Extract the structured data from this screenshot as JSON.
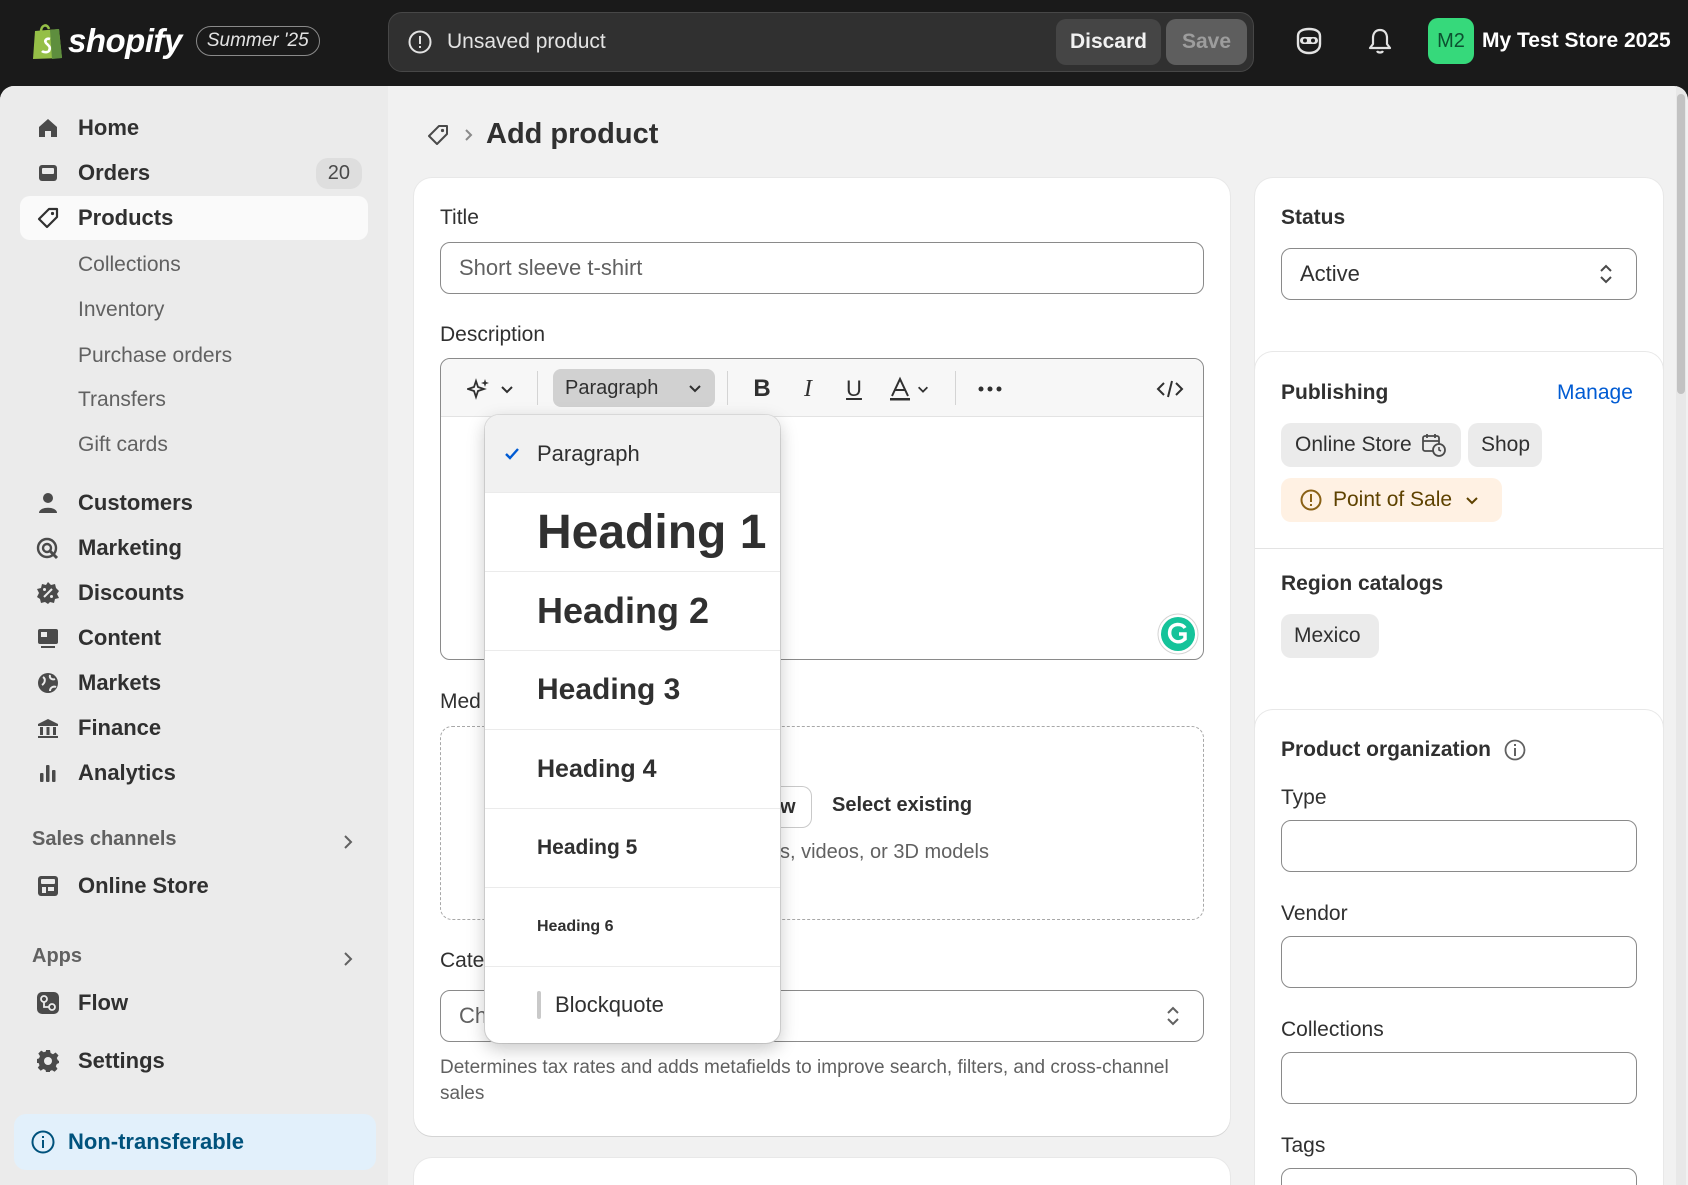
{
  "topbar": {
    "brand": "shopify",
    "edition": "Summer '25",
    "unsaved_text": "Unsaved product",
    "discard_label": "Discard",
    "save_label": "Save",
    "avatar_initials": "M2",
    "store_name": "My Test Store 2025"
  },
  "sidebar": {
    "items": [
      {
        "label": "Home",
        "icon": "home-icon"
      },
      {
        "label": "Orders",
        "icon": "orders-icon",
        "badge": "20"
      },
      {
        "label": "Products",
        "icon": "tag-icon"
      }
    ],
    "product_subitems": [
      "Collections",
      "Inventory",
      "Purchase orders",
      "Transfers",
      "Gift cards"
    ],
    "items2": [
      {
        "label": "Customers",
        "icon": "person-icon"
      },
      {
        "label": "Marketing",
        "icon": "target-icon"
      },
      {
        "label": "Discounts",
        "icon": "discount-icon"
      },
      {
        "label": "Content",
        "icon": "content-icon"
      },
      {
        "label": "Markets",
        "icon": "globe-icon"
      },
      {
        "label": "Finance",
        "icon": "bank-icon"
      },
      {
        "label": "Analytics",
        "icon": "bar-chart-icon"
      }
    ],
    "sales_channels_heading": "Sales channels",
    "online_store_label": "Online Store",
    "apps_heading": "Apps",
    "flow_label": "Flow",
    "settings_label": "Settings",
    "nontransferable_label": "Non-transferable"
  },
  "page": {
    "title": "Add product"
  },
  "main_card": {
    "title_label": "Title",
    "title_placeholder": "Short sleeve t-shirt",
    "description_label": "Description",
    "paragraph_select": "Paragraph",
    "media_label": "Med",
    "media_new_fragment": "w",
    "media_select_existing": "Select existing",
    "media_hint_fragment": "s, videos, or 3D models",
    "category_label": "Cate",
    "category_placeholder": "Ch",
    "category_help": "Determines tax rates and adds metafields to improve search, filters, and cross-channel sales"
  },
  "format_dropdown": {
    "options": [
      "Paragraph",
      "Heading 1",
      "Heading 2",
      "Heading 3",
      "Heading 4",
      "Heading 5",
      "Heading 6",
      "Blockquote"
    ],
    "selected": "Paragraph"
  },
  "status_card": {
    "label": "Status",
    "value": "Active"
  },
  "publishing_card": {
    "label": "Publishing",
    "manage": "Manage",
    "channels": [
      "Online Store",
      "Shop"
    ],
    "pos": "Point of Sale",
    "region_label": "Region catalogs",
    "region": "Mexico"
  },
  "organization_card": {
    "label": "Product organization",
    "type_label": "Type",
    "vendor_label": "Vendor",
    "collections_label": "Collections",
    "tags_label": "Tags"
  },
  "colors": {
    "topbar": "#1a1a1a",
    "accent_link": "#005bd3",
    "avatar": "#36d97b",
    "warning_bg": "#fff1e3"
  }
}
